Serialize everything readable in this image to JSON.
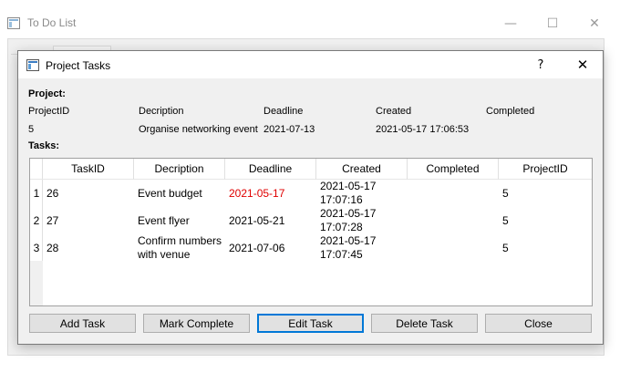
{
  "main_window": {
    "title": "To Do List",
    "controls": {
      "minimize": "—",
      "maximize": "☐",
      "close": "✕"
    }
  },
  "dialog": {
    "title": "Project Tasks",
    "help": "?",
    "close": "✕",
    "project_section": {
      "label": "Project:",
      "headers": [
        "ProjectID",
        "Decription",
        "Deadline",
        "Created",
        "Completed"
      ],
      "values": [
        "5",
        "Organise networking event",
        "2021-07-13",
        "2021-05-17 17:06:53",
        ""
      ]
    },
    "tasks_section": {
      "label": "Tasks:",
      "columns": [
        "TaskID",
        "Decription",
        "Deadline",
        "Created",
        "Completed",
        "ProjectID"
      ],
      "rows": [
        {
          "num": "1",
          "task_id": "26",
          "description": [
            "Event budget"
          ],
          "deadline": "2021-05-17",
          "deadline_overdue": true,
          "created": [
            "2021-05-17",
            "17:07:16"
          ],
          "completed": "",
          "project_id": "5"
        },
        {
          "num": "2",
          "task_id": "27",
          "description": [
            "Event flyer"
          ],
          "deadline": "2021-05-21",
          "deadline_overdue": false,
          "created": [
            "2021-05-17",
            "17:07:28"
          ],
          "completed": "",
          "project_id": "5"
        },
        {
          "num": "3",
          "task_id": "28",
          "description": [
            "Confirm numbers",
            "with venue"
          ],
          "deadline": "2021-07-06",
          "deadline_overdue": false,
          "created": [
            "2021-05-17",
            "17:07:45"
          ],
          "completed": "",
          "project_id": "5"
        }
      ]
    },
    "buttons": {
      "add_task": "Add Task",
      "mark_complete": "Mark Complete",
      "edit_task": "Edit Task",
      "delete_task": "Delete Task",
      "close": "Close"
    },
    "colors": {
      "overdue": "#e00000",
      "focus_border": "#0078d7"
    }
  }
}
